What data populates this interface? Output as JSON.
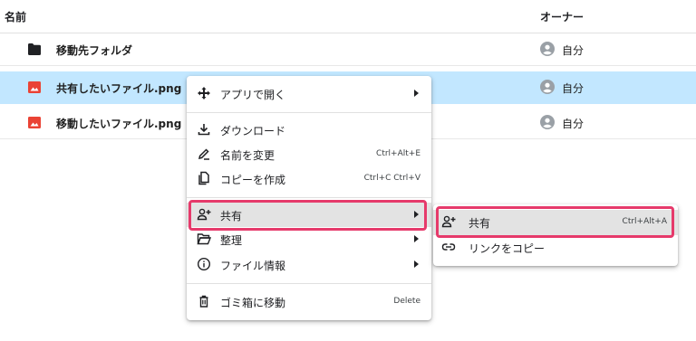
{
  "header": {
    "name_col": "名前",
    "owner_col": "オーナー"
  },
  "files": [
    {
      "name": "移動先フォルダ",
      "type": "folder",
      "owner": "自分",
      "selected": false
    },
    {
      "name": "共有したいファイル.png",
      "type": "image",
      "owner": "自分",
      "selected": true
    },
    {
      "name": "移動したいファイル.png",
      "type": "image",
      "owner": "自分",
      "selected": false
    }
  ],
  "context_menu": {
    "open_with": "アプリで開く",
    "download": "ダウンロード",
    "rename": "名前を変更",
    "rename_shortcut": "Ctrl+Alt+E",
    "copy": "コピーを作成",
    "copy_shortcut": "Ctrl+C Ctrl+V",
    "share": "共有",
    "organize": "整理",
    "file_info": "ファイル情報",
    "trash": "ゴミ箱に移動",
    "trash_shortcut": "Delete"
  },
  "share_submenu": {
    "share": "共有",
    "share_shortcut": "Ctrl+Alt+A",
    "copy_link": "リンクをコピー"
  },
  "colors": {
    "selected_row": "#c2e7ff",
    "highlight": "#e63a6b",
    "image_icon": "#ea4335",
    "folder_icon": "#202124"
  },
  "icons": {
    "folder": "folder-icon",
    "image": "image-file-icon",
    "owner": "account-circle-icon",
    "open_with": "open-with-icon",
    "download": "download-icon",
    "rename": "pencil-icon",
    "copy": "copy-icon",
    "share": "person-add-icon",
    "organize": "folder-open-icon",
    "info": "info-icon",
    "trash": "trash-icon",
    "link": "link-icon"
  }
}
